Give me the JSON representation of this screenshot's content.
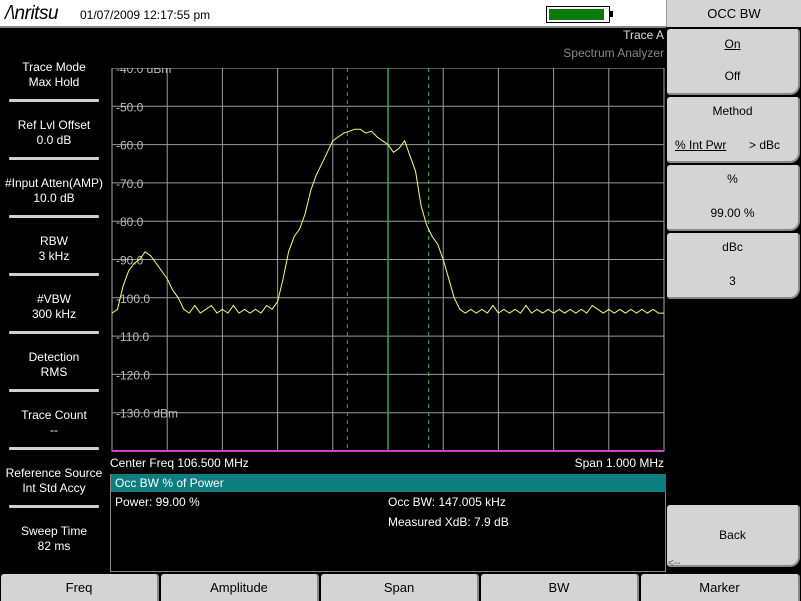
{
  "header": {
    "logo": "/\\nritsu",
    "datetime": "01/07/2009 12:17:55 pm",
    "battery_level": 0.95,
    "battery_color": "#0a7a0a"
  },
  "left_panel": [
    {
      "label": "Trace Mode",
      "value": "Max Hold"
    },
    {
      "label": "Ref Lvl Offset",
      "value": "0.0 dB"
    },
    {
      "label": "#Input Atten(AMP)",
      "value": "10.0 dB"
    },
    {
      "label": "RBW",
      "value": "3 kHz"
    },
    {
      "label": "#VBW",
      "value": "300 kHz"
    },
    {
      "label": "Detection",
      "value": "RMS"
    },
    {
      "label": "Trace Count",
      "value": "--"
    },
    {
      "label": "Reference Source",
      "value": "Int Std Accy"
    },
    {
      "label": "Sweep Time",
      "value": "82 ms"
    }
  ],
  "plot": {
    "trace_label": "Trace A",
    "mode_label": "Spectrum Analyzer",
    "center_freq": "Center Freq 106.500 MHz",
    "span": "Span 1.000 MHz"
  },
  "chart_data": {
    "type": "line",
    "y_tick_labels": [
      "-40.0 dBm",
      "-50.0",
      "-60.0",
      "-70.0",
      "-80.0",
      "-90.0",
      "-100.0",
      "-110.0",
      "-120.0",
      "-130.0 dBm"
    ],
    "ylim": [
      -140,
      -40
    ],
    "xlim": [
      106.0,
      107.0
    ],
    "x_unit": "MHz",
    "grid": true,
    "trace_color": "#ffff66",
    "marker_lines_mhz": {
      "center": 106.5,
      "occ_bw_left": 106.4265,
      "occ_bw_right": 106.5735
    },
    "series": [
      {
        "x": [
          106.0,
          106.01,
          106.02,
          106.03,
          106.04,
          106.05,
          106.06,
          106.07,
          106.08,
          106.09,
          106.1,
          106.11,
          106.12,
          106.13,
          106.14,
          106.15,
          106.16,
          106.17,
          106.18,
          106.19,
          106.2,
          106.21,
          106.22,
          106.23,
          106.24,
          106.25,
          106.26,
          106.27,
          106.28,
          106.29,
          106.3,
          106.31,
          106.32,
          106.33,
          106.34,
          106.35,
          106.36,
          106.37,
          106.38,
          106.39,
          106.4,
          106.41,
          106.42,
          106.43,
          106.44,
          106.45,
          106.46,
          106.47,
          106.48,
          106.49,
          106.5,
          106.51,
          106.52,
          106.53,
          106.54,
          106.55,
          106.56,
          106.57,
          106.58,
          106.59,
          106.6,
          106.61,
          106.62,
          106.63,
          106.64,
          106.65,
          106.66,
          106.67,
          106.68,
          106.69,
          106.7,
          106.71,
          106.72,
          106.73,
          106.74,
          106.75,
          106.76,
          106.77,
          106.78,
          106.79,
          106.8,
          106.81,
          106.82,
          106.83,
          106.84,
          106.85,
          106.86,
          106.87,
          106.88,
          106.89,
          106.9,
          106.91,
          106.92,
          106.93,
          106.94,
          106.95,
          106.96,
          106.97,
          106.98,
          106.99,
          107.0
        ],
        "y": [
          -104,
          -103,
          -97,
          -93,
          -91,
          -90,
          -88,
          -89,
          -91,
          -93,
          -95,
          -98,
          -100,
          -103,
          -104,
          -102,
          -104,
          -103,
          -102,
          -104,
          -103,
          -104,
          -102,
          -104,
          -103,
          -104,
          -103,
          -104,
          -102,
          -103,
          -101,
          -95,
          -88,
          -84,
          -82,
          -78,
          -72,
          -68,
          -65,
          -62,
          -59,
          -58,
          -57,
          -56.5,
          -56,
          -56,
          -57,
          -56.5,
          -58,
          -59,
          -60,
          -62,
          -61,
          -59,
          -63,
          -67,
          -76,
          -81,
          -84,
          -86,
          -90,
          -95,
          -100,
          -103,
          -104,
          -103,
          -104,
          -103,
          -104,
          -102,
          -104,
          -103,
          -104,
          -103,
          -104,
          -102,
          -104,
          -103,
          -104,
          -103,
          -104,
          -103,
          -104,
          -103,
          -104,
          -103,
          -104,
          -102,
          -103,
          -104,
          -103,
          -104,
          -103,
          -104,
          -103,
          -104,
          -103,
          -104,
          -103,
          -104,
          -104
        ]
      }
    ]
  },
  "measurement": {
    "title": "Occ BW % of Power",
    "power": "Power: 99.00 %",
    "occ_bw": "Occ BW: 147.005 kHz",
    "measured_xdb": "Measured XdB: 7.9 dB"
  },
  "menu": {
    "title": "OCC BW",
    "on_off": {
      "on": "On",
      "off": "Off"
    },
    "method": {
      "label": "Method",
      "opt1": "% Int Pwr",
      "opt2": "> dBc"
    },
    "percent": {
      "label": "%",
      "value": "99.00 %"
    },
    "dbc": {
      "label": "dBc",
      "value": "3"
    },
    "back": "Back",
    "back_arrow": "<--"
  },
  "tabs": [
    "Freq",
    "Amplitude",
    "Span",
    "BW",
    "Marker"
  ]
}
